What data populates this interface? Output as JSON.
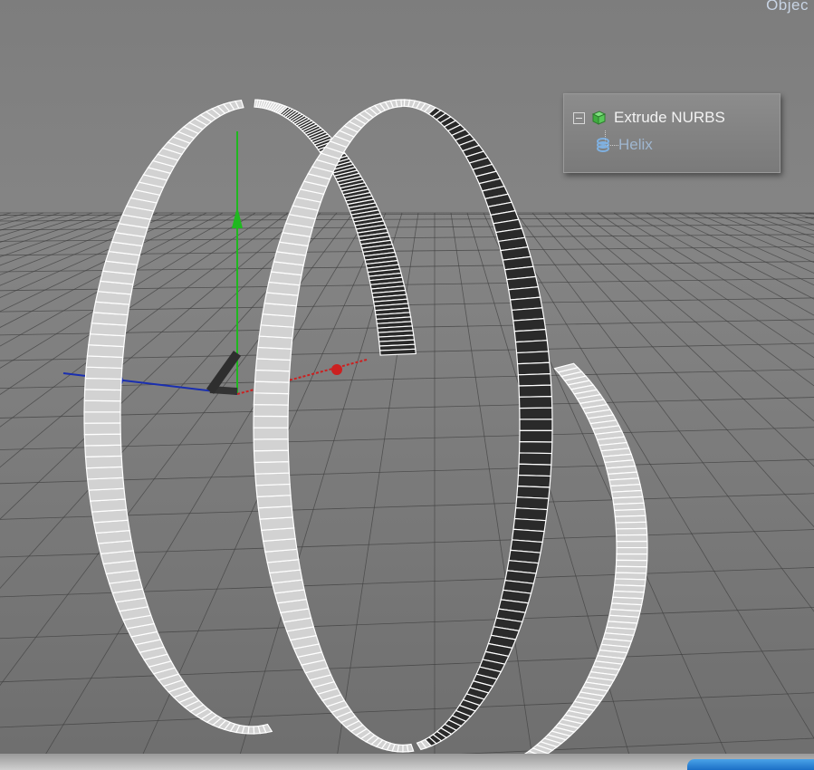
{
  "viewport": {
    "corner_label": "Objec"
  },
  "object_manager": {
    "items": [
      {
        "label": "Extrude NURBS",
        "icon": "extrude-nurbs-icon"
      },
      {
        "label": "Helix",
        "icon": "helix-spline-icon"
      }
    ]
  },
  "scene": {
    "objects": [
      "helix-extrusion",
      "world-axis",
      "ground-grid"
    ],
    "colors": {
      "background": "#7a7a7a",
      "grid_line": "#3f3f3f",
      "strip_face": "#d2d2d2",
      "strip_edge": "#ffffff",
      "axis_x": "#cc2020",
      "axis_y": "#1fb81f",
      "axis_z": "#1a2fb0"
    }
  },
  "status_bar": {
    "accent": "#1b6fc6"
  }
}
